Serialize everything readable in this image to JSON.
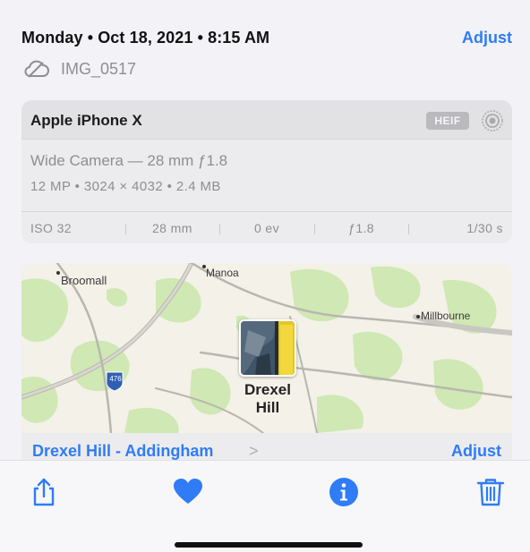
{
  "header": {
    "date_time": "Monday • Oct 18, 2021 • 8:15 AM",
    "adjust_label": "Adjust",
    "file_name": "IMG_0517"
  },
  "camera": {
    "device": "Apple iPhone X",
    "format_badge": "HEIF",
    "lens": "Wide Camera — 28 mm ƒ1.8",
    "specs": "12 MP  •  3024 × 4032  •  2.4 MB",
    "exif": {
      "iso": "ISO 32",
      "focal": "28 mm",
      "exposure": "0 ev",
      "aperture": "ƒ1.8",
      "shutter": "1/30 s"
    }
  },
  "map": {
    "labels": {
      "broomall": "Broomall",
      "manoa": "Manoa",
      "millbourne": "Millbourne",
      "drexel_hill_1": "Drexel",
      "drexel_hill_2": "Hill",
      "highway": "476"
    },
    "location_link": "Drexel Hill - Addingham",
    "chevron": ">",
    "adjust_label": "Adjust"
  },
  "colors": {
    "accent": "#2f7cf6",
    "secondary_text": "#8e8e93"
  },
  "icons": {
    "cloud": "cloud-icon",
    "live": "live-photo-icon",
    "share": "share-icon",
    "favorite": "heart-icon",
    "info": "info-icon",
    "delete": "trash-icon"
  }
}
